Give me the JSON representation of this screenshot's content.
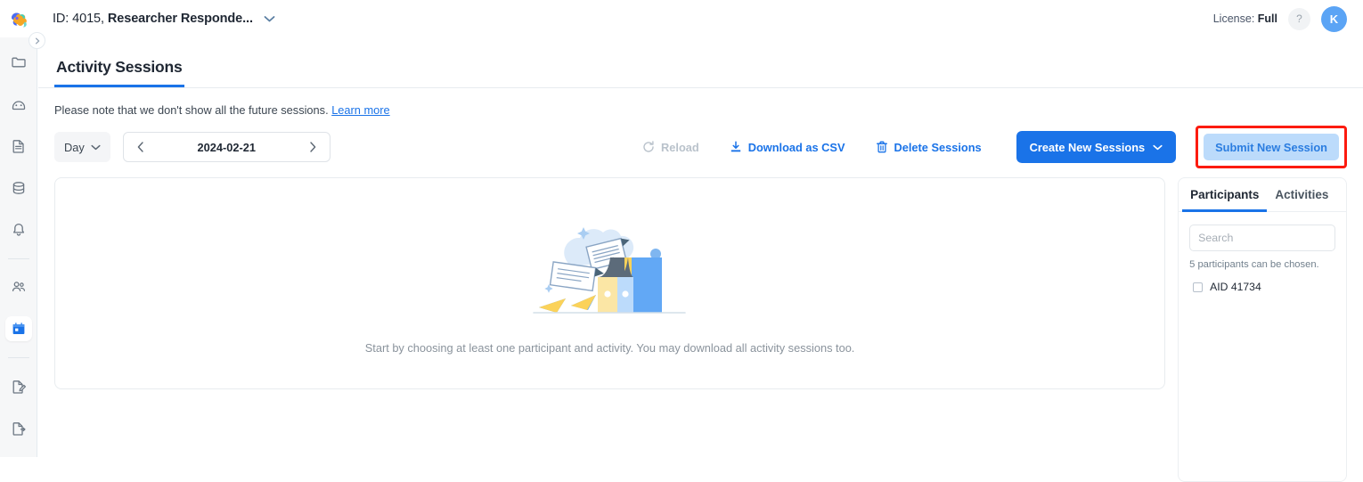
{
  "header": {
    "logo_icon": "brain-logo",
    "context_id_label": "ID: 4015,",
    "context_name_label": "Researcher Responde...",
    "context_chevron_icon": "chevron-down-icon",
    "license_label": "License:",
    "license_value": "Full",
    "help_label": "?",
    "avatar_initial": "K"
  },
  "sidebar": {
    "collapse_icon": "chevron-right-icon",
    "items": [
      {
        "name": "sidebar-item-folder",
        "icon": "folder-icon",
        "active": false
      },
      {
        "name": "sidebar-item-dashboard",
        "icon": "dashboard-gauge-icon",
        "active": false
      },
      {
        "name": "sidebar-item-documents",
        "icon": "document-icon",
        "active": false
      },
      {
        "name": "sidebar-item-database",
        "icon": "database-icon",
        "active": false
      },
      {
        "name": "sidebar-item-notifications",
        "icon": "bell-icon",
        "active": false
      },
      {
        "name": "sidebar-item-participants",
        "icon": "people-icon",
        "active": false
      },
      {
        "name": "sidebar-item-activity-sessions",
        "icon": "calendar-icon",
        "active": true
      },
      {
        "name": "sidebar-item-edit-document",
        "icon": "document-edit-icon",
        "active": false
      },
      {
        "name": "sidebar-item-export-document",
        "icon": "document-export-icon",
        "active": false
      }
    ]
  },
  "page": {
    "tab_label": "Activity Sessions",
    "notice_text": "Please note that we don't show all the future sessions.",
    "notice_link": "Learn more"
  },
  "toolbar": {
    "granularity_value": "Day",
    "granularity_chevron_icon": "chevron-down-icon",
    "prev_icon": "chevron-left-icon",
    "next_icon": "chevron-right-icon",
    "date_value": "2024-02-21",
    "reload_label": "Reload",
    "reload_icon": "refresh-icon",
    "download_label": "Download as CSV",
    "download_icon": "download-icon",
    "delete_label": "Delete Sessions",
    "delete_icon": "trash-icon",
    "create_label": "Create New Sessions",
    "create_chevron_icon": "chevron-down-icon",
    "submit_label": "Submit New Session",
    "highlight_color": "#fc1b0f",
    "accent_color": "#1a73e8",
    "soft_button_bg": "#bcdbfb",
    "soft_button_fg": "#2b7de0"
  },
  "main": {
    "empty_illustration": "no-data-flying-papers-illustration",
    "empty_text": "Start by choosing at least one participant and activity. You may download all activity sessions too."
  },
  "panel": {
    "tabs": [
      {
        "label": "Participants",
        "active": true
      },
      {
        "label": "Activities",
        "active": false
      }
    ],
    "search_placeholder": "Search",
    "search_value": "",
    "hint": "5 participants can be chosen.",
    "participants": [
      {
        "label": "AID 41734",
        "checked": false
      }
    ]
  }
}
